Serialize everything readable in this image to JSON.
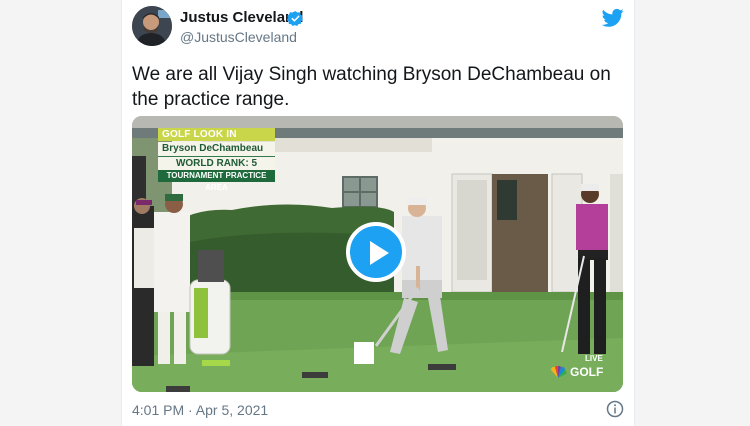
{
  "tweet": {
    "display_name": "Justus Cleveland",
    "handle": "@JustusCleveland",
    "text": "We are all Vijay Singh watching Bryson DeChambeau on the practice range.",
    "timestamp": "4:01 PM · Apr 5, 2021"
  },
  "video": {
    "overlay": {
      "brand": "GOLF LOOK IN",
      "player_name": "Bryson DeChambeau",
      "rank": "WORLD RANK: 5",
      "area": "TOURNAMENT PRACTICE AREA"
    },
    "live_label": "LIVE",
    "network": "GOLF"
  },
  "icons": {
    "verified": "verified-badge-icon",
    "brand": "twitter-bird-icon",
    "play": "play-icon",
    "info": "info-icon"
  },
  "colors": {
    "accent": "#1da1f2",
    "text_primary": "#14171a",
    "text_secondary": "#657786"
  }
}
